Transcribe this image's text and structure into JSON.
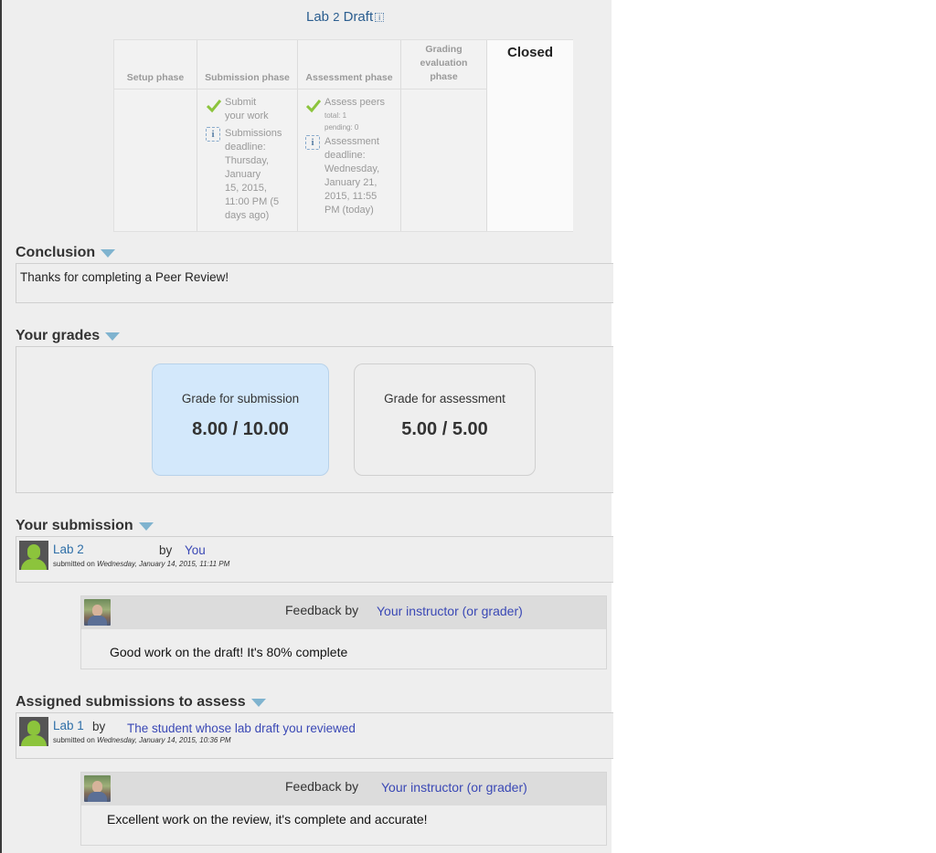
{
  "title": {
    "prefix": "Lab ",
    "number": "2",
    "suffix": " Draft",
    "info_icon": "i"
  },
  "phases": [
    {
      "name": "Setup phase",
      "active": false
    },
    {
      "name": "Submission phase",
      "active": false
    },
    {
      "name": "Assessment phase",
      "active": false
    },
    {
      "name_lines": [
        "Grading",
        "evaluation",
        "phase"
      ],
      "active": false
    },
    {
      "name": "Closed",
      "active": true
    }
  ],
  "submission_tasks": {
    "task1": [
      "Submit",
      "your work"
    ],
    "task2": [
      "Submissions",
      "deadline:",
      "Thursday,",
      "January",
      "15, 2015,",
      "11:00 PM (5",
      "days ago)"
    ]
  },
  "assessment_tasks": {
    "task1": "Assess peers",
    "total": "total: 1",
    "pending": "pending: 0",
    "task2": [
      "Assessment",
      "deadline:",
      "Wednesday,",
      "January 21,",
      "2015, 11:55",
      "PM (today)"
    ]
  },
  "conclusion": {
    "heading": "Conclusion",
    "text": "Thanks for completing a Peer Review!"
  },
  "grades": {
    "heading": "Your grades",
    "submission": {
      "label": "Grade for submission",
      "value": "8.00 / 10.00"
    },
    "assessment": {
      "label": "Grade for assessment",
      "value": "5.00 / 5.00"
    }
  },
  "your_submission": {
    "heading": "Your submission",
    "title": "Lab 2",
    "by": "by",
    "author": "You",
    "submitted_prefix": "submitted on ",
    "submitted_date": "Wednesday, January 14, 2015, 11:11 PM",
    "feedback": {
      "label": "Feedback by",
      "author": "Your instructor (or grader)",
      "text": "Good work on the draft! It's 80% complete"
    }
  },
  "assigned": {
    "heading": "Assigned submissions to assess",
    "title": "Lab 1",
    "by": "by",
    "author": "The student whose lab draft you reviewed",
    "submitted_prefix": "submitted on ",
    "submitted_date": "Wednesday, January 14, 2015, 10:36 PM",
    "feedback": {
      "label": "Feedback by",
      "author": "Your instructor (or grader)",
      "text": "Excellent work on the review, it's complete and accurate!"
    }
  },
  "colors": {
    "link": "#2f6fa8",
    "author": "#3a48b5",
    "check": "#8cc43c",
    "grade_highlight": "#d3e8fb",
    "caret": "#7fb3cf"
  }
}
